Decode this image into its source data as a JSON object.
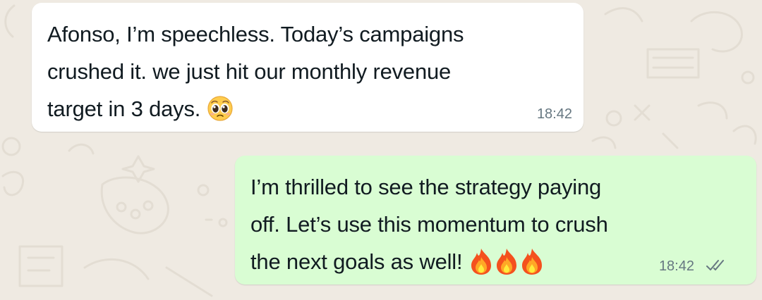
{
  "chat": {
    "messages": [
      {
        "direction": "incoming",
        "lines": [
          "Afonso, I’m speechless. Today’s campaigns",
          "crushed it. we just hit our monthly revenue",
          "target in 3 days."
        ],
        "emoji": "pleading-face-icon",
        "time": "18:42"
      },
      {
        "direction": "outgoing",
        "lines": [
          "I’m thrilled to see the strategy paying",
          "off. Let’s use this momentum to crush",
          "the next goals as well!"
        ],
        "emoji": [
          "fire-icon",
          "fire-icon",
          "fire-icon"
        ],
        "time": "18:42",
        "status": "read-double-check-icon"
      }
    ]
  },
  "colors": {
    "background": "#efeae2",
    "incoming_bubble": "#ffffff",
    "outgoing_bubble": "#d9fdd3",
    "text": "#111b21",
    "timestamp": "#667781"
  }
}
